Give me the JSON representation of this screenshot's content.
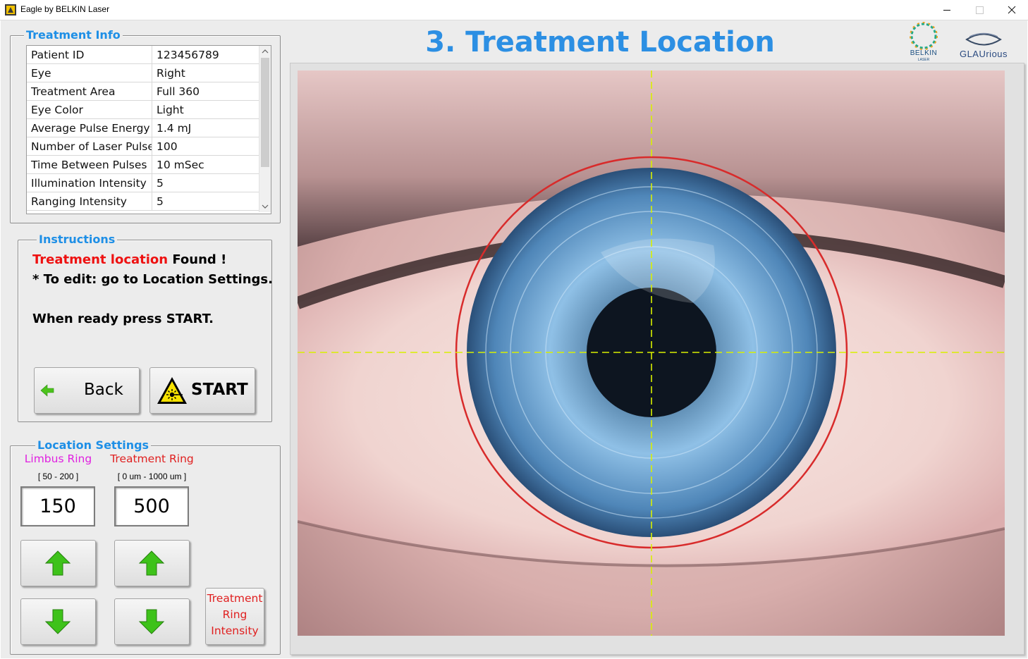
{
  "window": {
    "title": "Eagle by BELKIN Laser",
    "controls": [
      "minimize",
      "maximize",
      "close"
    ]
  },
  "page_title": "3. Treatment Location",
  "logos": {
    "belkin_text": "BELKIN",
    "belkin_sub": "LASER",
    "glaurious_text": "GLAUrious"
  },
  "treatment_info": {
    "legend": "Treatment Info",
    "rows": [
      {
        "key": "Patient ID",
        "value": "123456789"
      },
      {
        "key": "Eye",
        "value": "Right"
      },
      {
        "key": "Treatment Area",
        "value": "Full 360"
      },
      {
        "key": "Eye Color",
        "value": "Light"
      },
      {
        "key": "Average Pulse Energy",
        "value": "1.4 mJ"
      },
      {
        "key": "Number of Laser Pulse",
        "value": "100"
      },
      {
        "key": "Time Between Pulses",
        "value": "10 mSec"
      },
      {
        "key": "Illumination Intensity",
        "value": "5"
      },
      {
        "key": "Ranging Intensity",
        "value": "5"
      }
    ]
  },
  "instructions": {
    "legend": "Instructions",
    "line1_red": "Treatment location",
    "line1_rest": " Found !",
    "line2": "* To edit: go to Location Settings.",
    "line3": "When ready press START.",
    "back_label": "Back",
    "start_label": "START"
  },
  "location_settings": {
    "legend": "Location Settings",
    "limbus": {
      "label": "Limbus Ring",
      "range": "[ 50 - 200 ]",
      "value": "150",
      "color": "#e020e0"
    },
    "treatment": {
      "label": "Treatment Ring",
      "range": "[ 0 um - 1000 um ]",
      "value": "500",
      "color": "#e02020"
    },
    "intensity_button": {
      "line1": "Treatment",
      "line2": "Ring",
      "line3": "Intensity",
      "color": "#e02020"
    }
  },
  "colors": {
    "accent": "#2c8fe3",
    "instruction_red": "#ee1111",
    "ring_red": "#d82b2b",
    "crosshair": "#d8f000"
  }
}
